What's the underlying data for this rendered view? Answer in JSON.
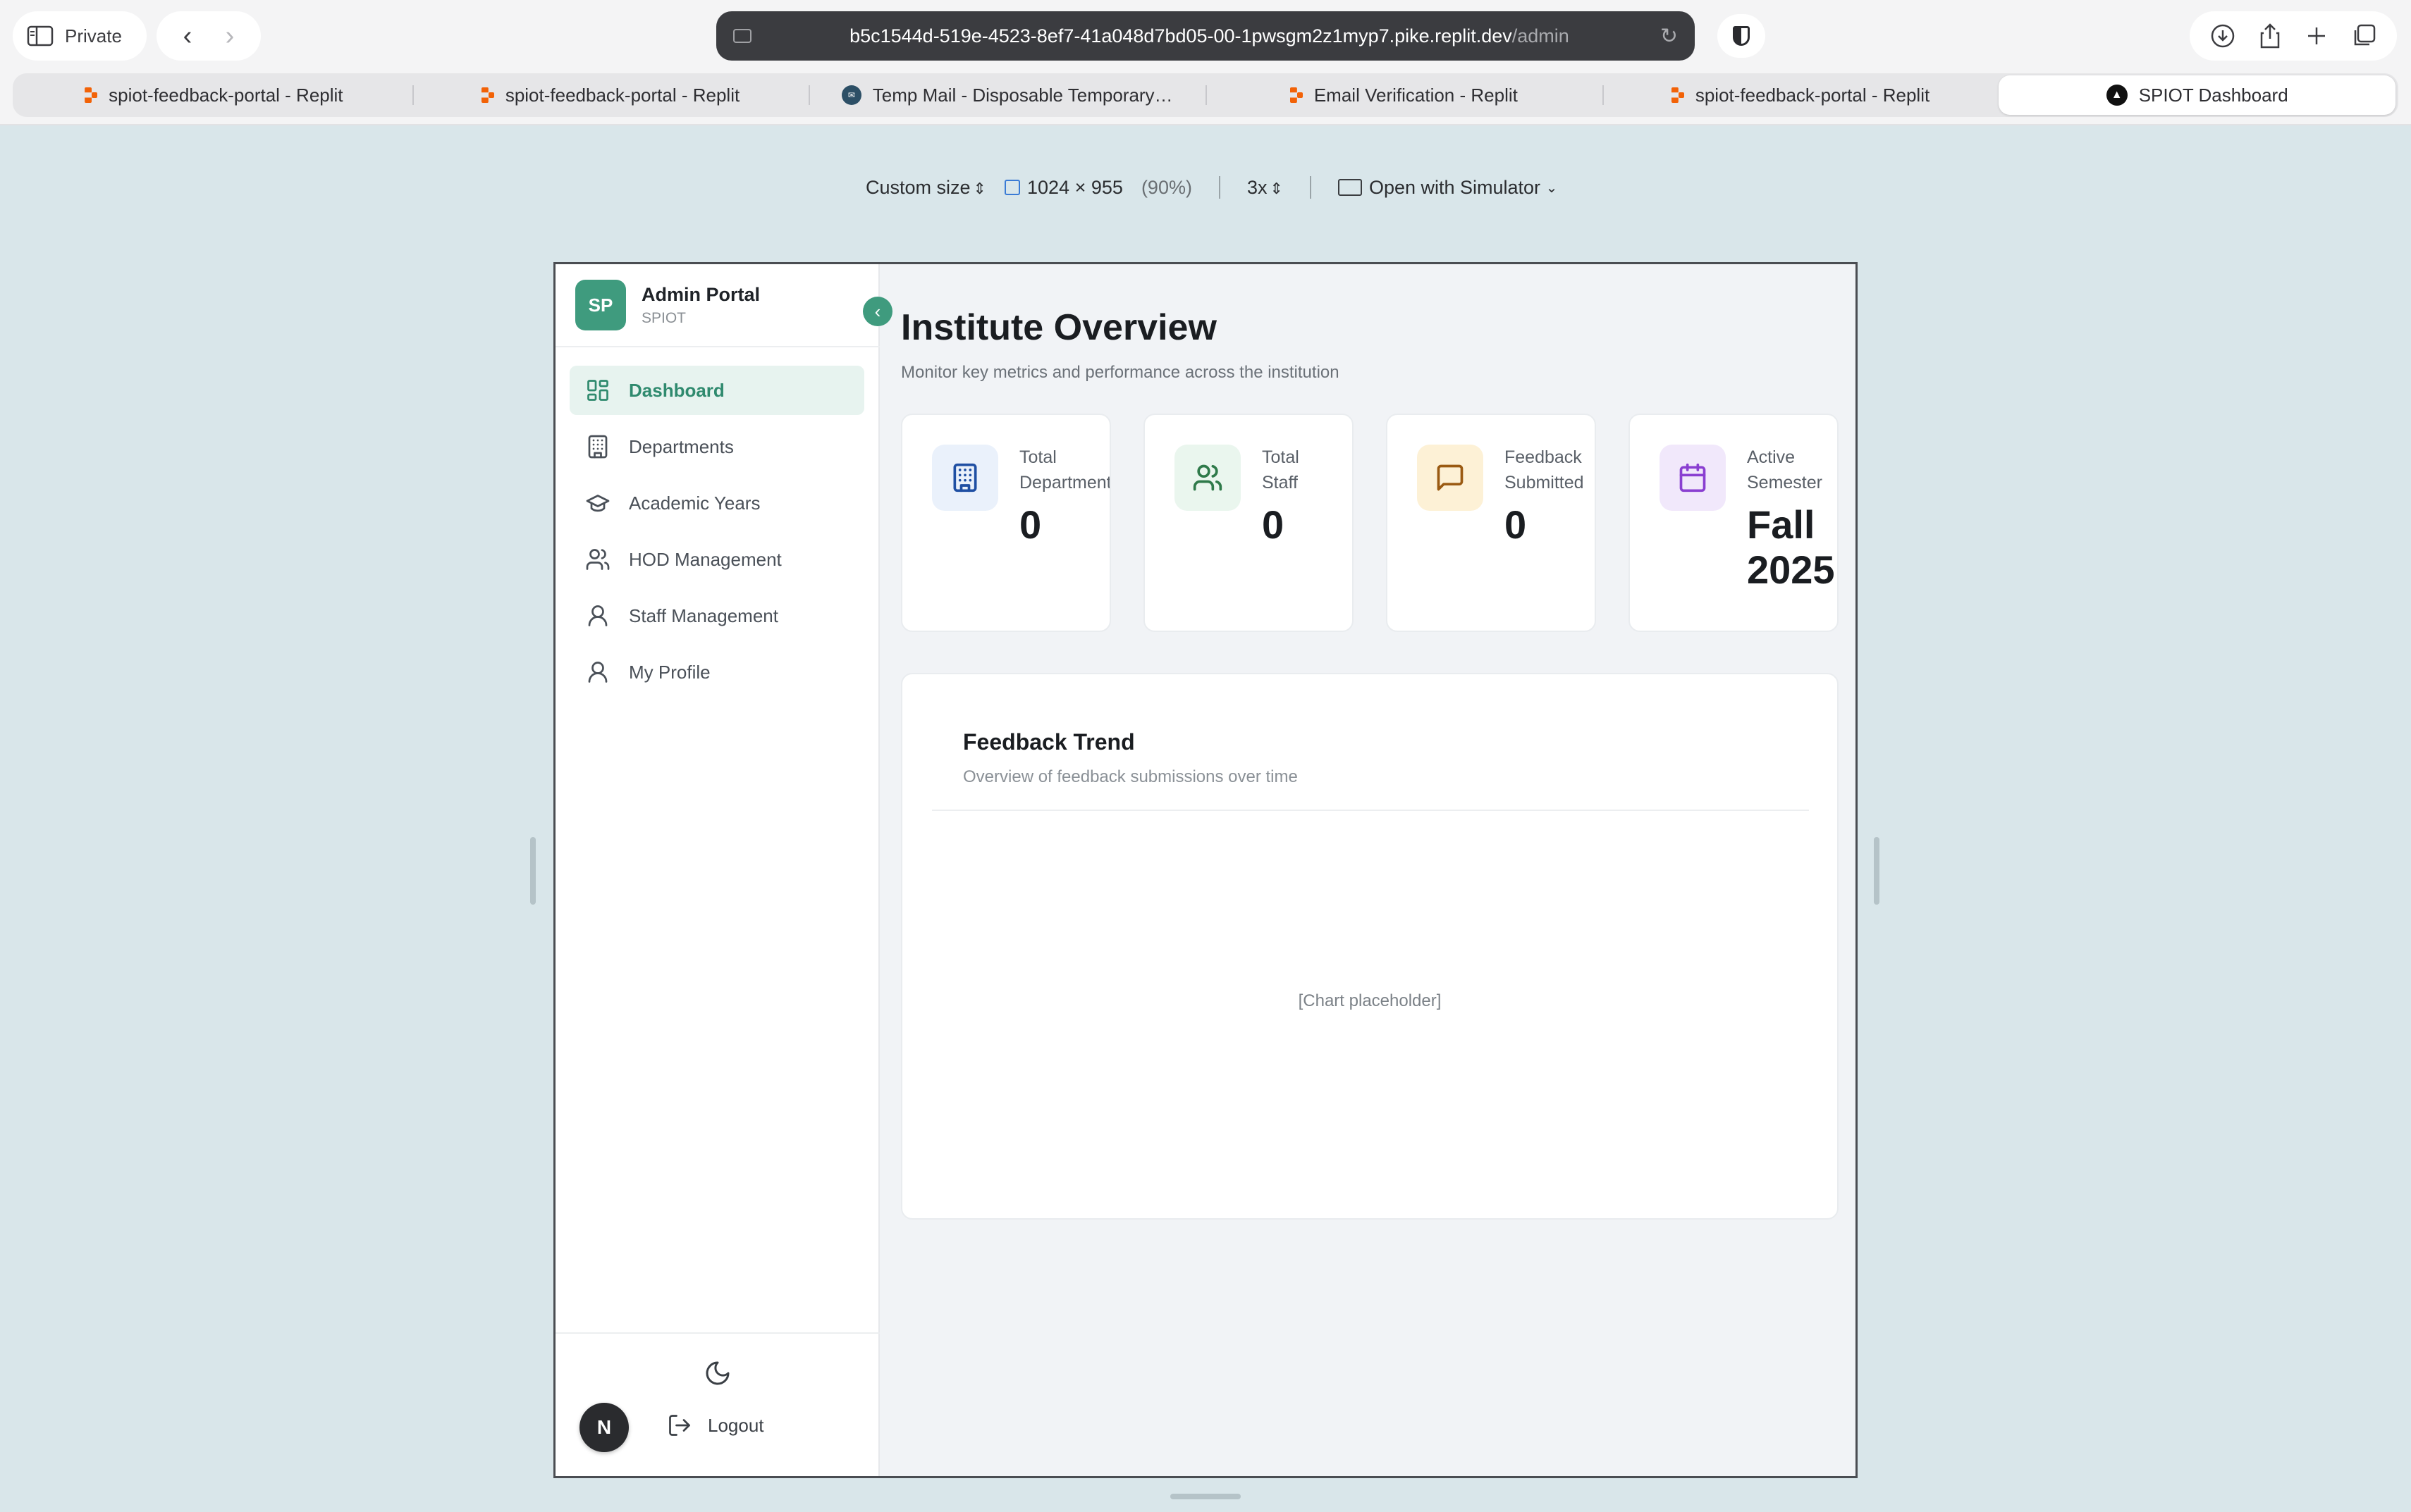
{
  "browser": {
    "private_label": "Private",
    "url_host": "b5c1544d-519e-4523-8ef7-41a048d7bd05-00-1pwsgm2z1myp7.pike.replit.dev",
    "url_path": "/admin",
    "tabs": [
      {
        "label": "spiot-feedback-portal - Replit",
        "favicon": "replit-icon"
      },
      {
        "label": "spiot-feedback-portal - Replit",
        "favicon": "replit-icon"
      },
      {
        "label": "Temp Mail - Disposable Temporary…",
        "favicon": "tempmail-icon"
      },
      {
        "label": "Email Verification - Replit",
        "favicon": "replit-icon"
      },
      {
        "label": "spiot-feedback-portal - Replit",
        "favicon": "replit-icon"
      },
      {
        "label": "SPIOT Dashboard",
        "favicon": "spiot-icon",
        "active": true
      }
    ]
  },
  "simulator": {
    "size_label": "Custom size",
    "width": "1024",
    "times": "×",
    "height": "955",
    "zoom": "(90%)",
    "scale": "3x",
    "open_label": "Open with Simulator"
  },
  "sidebar": {
    "logo_text": "SP",
    "title": "Admin Portal",
    "subtitle": "SPIOT",
    "items": [
      {
        "label": "Dashboard",
        "icon": "dashboard-icon",
        "active": true
      },
      {
        "label": "Departments",
        "icon": "building-icon"
      },
      {
        "label": "Academic Years",
        "icon": "graduation-cap-icon"
      },
      {
        "label": "HOD Management",
        "icon": "users-icon"
      },
      {
        "label": "Staff Management",
        "icon": "user-icon"
      },
      {
        "label": "My Profile",
        "icon": "user-icon"
      }
    ],
    "avatar_letter": "N",
    "logout_label": "Logout"
  },
  "main": {
    "title": "Institute Overview",
    "subtitle": "Monitor key metrics and performance across the institution",
    "stats": [
      {
        "label": "Total\nDepartments",
        "value": "0",
        "icon": "building-icon",
        "bg": "#eaf1fb",
        "color": "#1f4fa3"
      },
      {
        "label": "Total\nStaff",
        "value": "0",
        "icon": "users-icon",
        "bg": "#eaf6ee",
        "color": "#2f7a4a"
      },
      {
        "label": "Feedback\nSubmitted",
        "value": "0",
        "icon": "message-icon",
        "bg": "#fdf1d6",
        "color": "#9a5a12"
      },
      {
        "label": "Active\nSemester",
        "value": "Fall\n2025",
        "icon": "calendar-icon",
        "bg": "#f1e8fb",
        "color": "#8a3fd1"
      }
    ],
    "trend": {
      "title": "Feedback Trend",
      "subtitle": "Overview of feedback submissions over time",
      "placeholder": "[Chart placeholder]"
    }
  },
  "colors": {
    "accent": "#3f9b7e",
    "active_bg": "#e7f3ef"
  }
}
